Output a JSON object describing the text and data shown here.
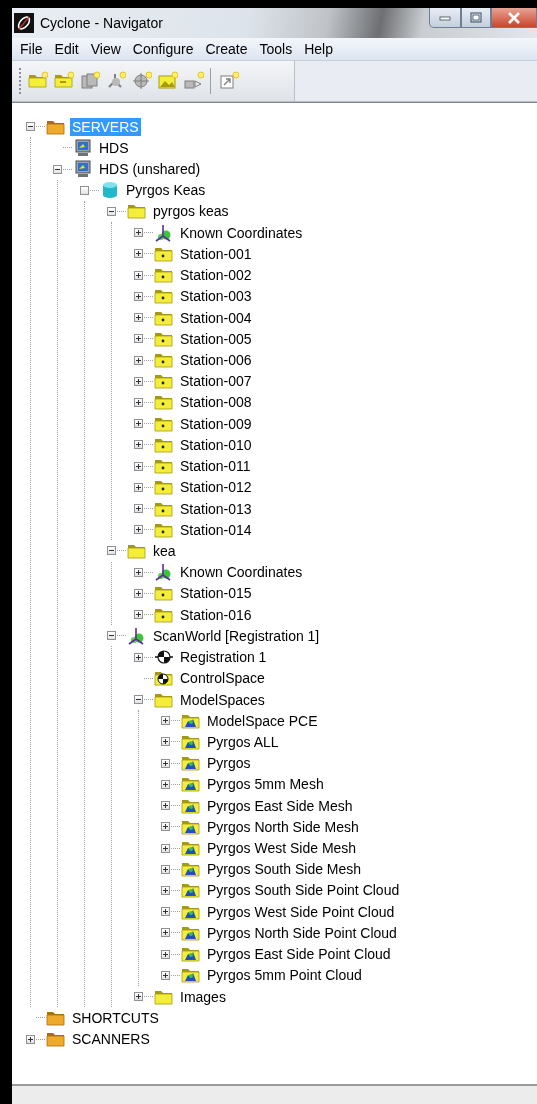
{
  "window": {
    "title": "Cyclone - Navigator"
  },
  "menu": [
    {
      "label": "File"
    },
    {
      "label": "Edit"
    },
    {
      "label": "View"
    },
    {
      "label": "Configure"
    },
    {
      "label": "Create"
    },
    {
      "label": "Tools"
    },
    {
      "label": "Help"
    }
  ],
  "toolbar": [
    {
      "kind": "folder",
      "disabled": false
    },
    {
      "kind": "station",
      "disabled": false
    },
    {
      "kind": "copy",
      "disabled": true
    },
    {
      "kind": "coordinates",
      "disabled": true
    },
    {
      "kind": "target",
      "disabled": true
    },
    {
      "kind": "image",
      "disabled": false
    },
    {
      "kind": "scanner",
      "disabled": true
    },
    {
      "kind": "separator"
    },
    {
      "kind": "shortcut",
      "disabled": true
    }
  ],
  "tree": [
    {
      "label": "SERVERS",
      "kind": "server-folder",
      "expanded": true,
      "selected": true,
      "children": [
        {
          "label": "HDS",
          "kind": "computer",
          "selected": false
        },
        {
          "label": "HDS (unshared)",
          "kind": "computer",
          "expanded": true,
          "selected": false,
          "children": [
            {
              "label": "Pyrgos Keas",
              "kind": "database",
              "expanded": true,
              "selected": false,
              "children": [
                {
                  "label": "pyrgos keas",
                  "kind": "folder",
                  "expanded": true,
                  "selected": false,
                  "children": [
                    {
                      "label": "Known Coordinates",
                      "kind": "coordinates",
                      "expanded": false,
                      "selected": false
                    },
                    {
                      "label": "Station-001",
                      "kind": "station",
                      "expanded": false,
                      "selected": false
                    },
                    {
                      "label": "Station-002",
                      "kind": "station",
                      "expanded": false,
                      "selected": false
                    },
                    {
                      "label": "Station-003",
                      "kind": "station",
                      "expanded": false,
                      "selected": false
                    },
                    {
                      "label": "Station-004",
                      "kind": "station",
                      "expanded": false,
                      "selected": false
                    },
                    {
                      "label": "Station-005",
                      "kind": "station",
                      "expanded": false,
                      "selected": false
                    },
                    {
                      "label": "Station-006",
                      "kind": "station",
                      "expanded": false,
                      "selected": false
                    },
                    {
                      "label": "Station-007",
                      "kind": "station",
                      "expanded": false,
                      "selected": false
                    },
                    {
                      "label": "Station-008",
                      "kind": "station",
                      "expanded": false,
                      "selected": false
                    },
                    {
                      "label": "Station-009",
                      "kind": "station",
                      "expanded": false,
                      "selected": false
                    },
                    {
                      "label": "Station-010",
                      "kind": "station",
                      "expanded": false,
                      "selected": false
                    },
                    {
                      "label": "Station-011",
                      "kind": "station",
                      "expanded": false,
                      "selected": false
                    },
                    {
                      "label": "Station-012",
                      "kind": "station",
                      "expanded": false,
                      "selected": false
                    },
                    {
                      "label": "Station-013",
                      "kind": "station",
                      "expanded": false,
                      "selected": false
                    },
                    {
                      "label": "Station-014",
                      "kind": "station",
                      "expanded": false,
                      "selected": false
                    }
                  ]
                },
                {
                  "label": "kea",
                  "kind": "folder",
                  "expanded": true,
                  "selected": false,
                  "children": [
                    {
                      "label": "Known Coordinates",
                      "kind": "coordinates",
                      "expanded": false,
                      "selected": false
                    },
                    {
                      "label": "Station-015",
                      "kind": "station",
                      "expanded": false,
                      "selected": false
                    },
                    {
                      "label": "Station-016",
                      "kind": "station",
                      "expanded": false,
                      "selected": false
                    }
                  ]
                },
                {
                  "label": "ScanWorld [Registration 1]",
                  "kind": "coordinates",
                  "expanded": true,
                  "selected": false,
                  "children": [
                    {
                      "label": "Registration 1",
                      "kind": "registration",
                      "expanded": false,
                      "selected": false
                    },
                    {
                      "label": "ControlSpace",
                      "kind": "controlspace",
                      "selected": false
                    },
                    {
                      "label": "ModelSpaces",
                      "kind": "folder",
                      "expanded": true,
                      "selected": false,
                      "children": [
                        {
                          "label": "ModelSpace PCE",
                          "kind": "modelspace",
                          "expanded": false,
                          "selected": false
                        },
                        {
                          "label": "Pyrgos ALL",
                          "kind": "modelspace",
                          "expanded": false,
                          "selected": false
                        },
                        {
                          "label": "Pyrgos",
                          "kind": "modelspace",
                          "expanded": false,
                          "selected": false
                        },
                        {
                          "label": "Pyrgos 5mm Mesh",
                          "kind": "modelspace",
                          "expanded": false,
                          "selected": false
                        },
                        {
                          "label": "Pyrgos East Side Mesh",
                          "kind": "modelspace",
                          "expanded": false,
                          "selected": false
                        },
                        {
                          "label": "Pyrgos North Side Mesh",
                          "kind": "modelspace",
                          "expanded": false,
                          "selected": false
                        },
                        {
                          "label": "Pyrgos West Side Mesh",
                          "kind": "modelspace",
                          "expanded": false,
                          "selected": false
                        },
                        {
                          "label": "Pyrgos South Side Mesh",
                          "kind": "modelspace",
                          "expanded": false,
                          "selected": false
                        },
                        {
                          "label": "Pyrgos South Side Point Cloud",
                          "kind": "modelspace",
                          "expanded": false,
                          "selected": false
                        },
                        {
                          "label": "Pyrgos West Side Point Cloud",
                          "kind": "modelspace",
                          "expanded": false,
                          "selected": false
                        },
                        {
                          "label": "Pyrgos North Side Point Cloud",
                          "kind": "modelspace",
                          "expanded": false,
                          "selected": false
                        },
                        {
                          "label": "Pyrgos East Side Point Cloud",
                          "kind": "modelspace",
                          "expanded": false,
                          "selected": false
                        },
                        {
                          "label": "Pyrgos 5mm Point Cloud",
                          "kind": "modelspace",
                          "expanded": false,
                          "selected": false
                        }
                      ]
                    },
                    {
                      "label": "Images",
                      "kind": "folder",
                      "expanded": false,
                      "selected": false
                    }
                  ]
                }
              ]
            }
          ]
        }
      ]
    },
    {
      "label": "SHORTCUTS",
      "kind": "server-folder",
      "selected": false
    },
    {
      "label": "SCANNERS",
      "kind": "server-folder",
      "expanded": false,
      "selected": false
    }
  ]
}
